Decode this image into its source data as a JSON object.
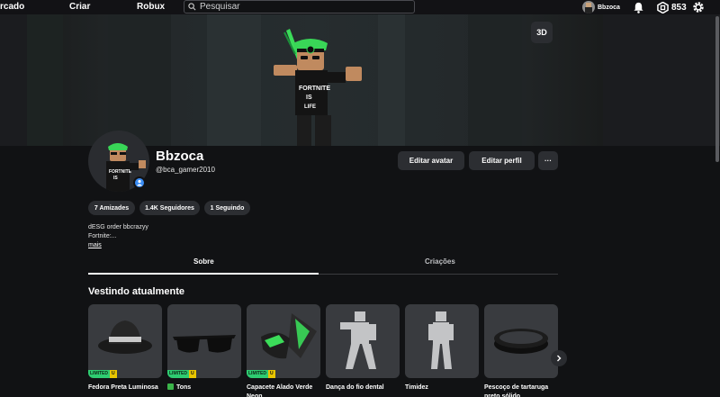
{
  "nav": {
    "links": [
      "rcado",
      "Criar",
      "Robux"
    ],
    "search_placeholder": "Pesquisar",
    "username": "Bbzoca",
    "robux": "853"
  },
  "banner": {
    "view_3d": "3D"
  },
  "profile": {
    "display_name": "Bbzoca",
    "username": "@bca_gamer2010",
    "edit_avatar": "Editar avatar",
    "edit_profile": "Editar perfil",
    "more_menu": "···",
    "friends": "7 Amizades",
    "followers": "1.4K Seguidores",
    "following": "1 Seguindo",
    "bio_line1": "dESG order bbcrazyy",
    "bio_line2": "Fortnite:...",
    "more_link": "mais"
  },
  "tabs": [
    "Sobre",
    "Criações"
  ],
  "wearing": {
    "title": "Vestindo atualmente",
    "limited_label": "LIMITED",
    "limited_u": "U",
    "items": [
      {
        "name": "Fedora Preta Luminosa",
        "limited": true
      },
      {
        "name": "Tons",
        "limited": true
      },
      {
        "name": "Capacete Alado Verde Neon",
        "limited": true
      },
      {
        "name": "Dança do fio dental",
        "limited": false
      },
      {
        "name": "Timidez",
        "limited": false
      },
      {
        "name": "Pescoço de tartaruga preto sólido",
        "limited": false
      }
    ]
  },
  "colors": {
    "accent_green": "#2ecc71",
    "accent_yellow": "#e8c500",
    "verified_blue": "#3a8df5"
  }
}
